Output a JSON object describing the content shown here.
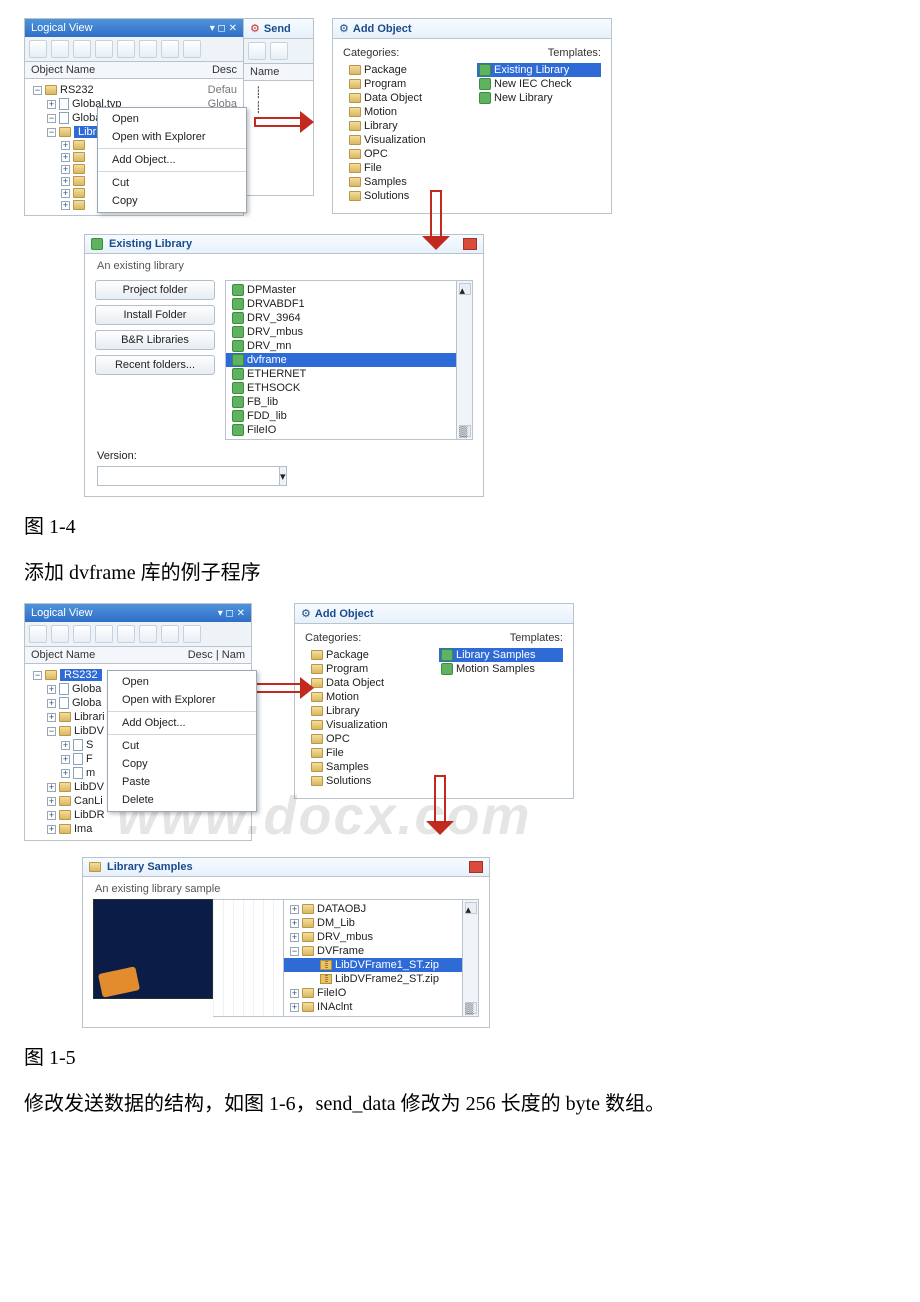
{
  "caption1": "图 1-4",
  "text_between": "添加 dvframe 库的例子程序",
  "caption2": "图 1-5",
  "text_after": "修改发送数据的结构，如图 1-6，send_data 修改为 256 长度的 byte 数组。",
  "watermark": "www.docx.com",
  "fig1": {
    "logical_view": {
      "title": "Logical View",
      "col_name": "Object Name",
      "col_desc": "Desc",
      "rows": [
        {
          "indent": 0,
          "exp": "−",
          "icon": "folder",
          "label": "RS232",
          "right": "Defau"
        },
        {
          "indent": 1,
          "exp": "+",
          "icon": "file",
          "label": "Global.typ",
          "right": "Globa"
        },
        {
          "indent": 1,
          "exp": "−",
          "icon": "file",
          "label": "Global.var",
          "right": "Globa"
        },
        {
          "indent": 1,
          "exp": "−",
          "icon": "folder",
          "label": "Libra",
          "right": "",
          "selected": true
        },
        {
          "indent": 2,
          "exp": "+",
          "icon": "folder",
          "label": "",
          "right": ""
        },
        {
          "indent": 2,
          "exp": "+",
          "icon": "folder",
          "label": "",
          "right": ""
        },
        {
          "indent": 2,
          "exp": "+",
          "icon": "folder",
          "label": "",
          "right": ""
        },
        {
          "indent": 2,
          "exp": "+",
          "icon": "folder",
          "label": "",
          "right": ""
        },
        {
          "indent": 2,
          "exp": "+",
          "icon": "folder",
          "label": "",
          "right": ""
        },
        {
          "indent": 2,
          "exp": "+",
          "icon": "folder",
          "label": "",
          "right": ""
        }
      ],
      "context_menu": [
        "Open",
        "Open with Explorer",
        "—",
        "Add Object...",
        "—",
        "Cut",
        "Copy"
      ]
    },
    "send_panel": {
      "title": "Send",
      "col": "Name"
    },
    "add_object": {
      "title": "Add Object",
      "cat_label": "Categories:",
      "tpl_label": "Templates:",
      "categories": [
        "Package",
        "Program",
        "Data Object",
        "Motion",
        "Library",
        "Visualization",
        "OPC",
        "File",
        "Samples",
        "Solutions"
      ],
      "templates": [
        {
          "label": "Existing Library",
          "sel": true
        },
        {
          "label": "New IEC Check",
          "sel": false
        },
        {
          "label": "New Library",
          "sel": false
        }
      ]
    },
    "existing_lib": {
      "title": "Existing Library",
      "subtitle": "An existing library",
      "buttons": [
        "Project folder",
        "Install Folder",
        "B&R Libraries",
        "Recent folders..."
      ],
      "version_label": "Version:",
      "libs": [
        "DPMaster",
        "DRVABDF1",
        "DRV_3964",
        "DRV_mbus",
        "DRV_mn",
        "dvframe",
        "ETHERNET",
        "ETHSOCK",
        "FB_lib",
        "FDD_lib",
        "FileIO"
      ]
    }
  },
  "fig2": {
    "logical_view": {
      "title": "Logical View",
      "col_name": "Object Name",
      "col_desc": "Desc",
      "col_name2": "Nam",
      "rows": [
        {
          "indent": 0,
          "exp": "−",
          "icon": "folder",
          "label": "RS232",
          "right": "",
          "selected": true
        },
        {
          "indent": 1,
          "exp": "+",
          "icon": "file",
          "label": "Globa",
          "right": ""
        },
        {
          "indent": 1,
          "exp": "+",
          "icon": "file",
          "label": "Globa",
          "right": ""
        },
        {
          "indent": 1,
          "exp": "+",
          "icon": "folder",
          "label": "Librari",
          "right": ""
        },
        {
          "indent": 1,
          "exp": "−",
          "icon": "folder",
          "label": "LibDV",
          "right": ""
        },
        {
          "indent": 2,
          "exp": "+",
          "icon": "file",
          "label": "S",
          "right": ""
        },
        {
          "indent": 2,
          "exp": "+",
          "icon": "file",
          "label": "F",
          "right": ""
        },
        {
          "indent": 2,
          "exp": "+",
          "icon": "file",
          "label": "m",
          "right": ""
        },
        {
          "indent": 1,
          "exp": "+",
          "icon": "folder",
          "label": "LibDV",
          "right": ""
        },
        {
          "indent": 1,
          "exp": "+",
          "icon": "folder",
          "label": "CanLi",
          "right": ""
        },
        {
          "indent": 1,
          "exp": "+",
          "icon": "folder",
          "label": "LibDR",
          "right": ""
        },
        {
          "indent": 1,
          "exp": "+",
          "icon": "folder",
          "label": "Ima",
          "right": ""
        }
      ],
      "context_menu": [
        "Open",
        "Open with Explorer",
        "—",
        "Add Object...",
        "—",
        "Cut",
        "Copy",
        "Paste",
        "Delete"
      ]
    },
    "add_object": {
      "title": "Add Object",
      "cat_label": "Categories:",
      "tpl_label": "Templates:",
      "categories": [
        "Package",
        "Program",
        "Data Object",
        "Motion",
        "Library",
        "Visualization",
        "OPC",
        "File",
        "Samples",
        "Solutions"
      ],
      "templates": [
        {
          "label": "Library Samples",
          "sel": true
        },
        {
          "label": "Motion Samples",
          "sel": false
        }
      ]
    },
    "lib_samples": {
      "title": "Library Samples",
      "subtitle": "An existing library sample",
      "tree": [
        {
          "exp": "+",
          "icon": "folder",
          "label": "DATAOBJ"
        },
        {
          "exp": "+",
          "icon": "folder",
          "label": "DM_Lib"
        },
        {
          "exp": "+",
          "icon": "folder",
          "label": "DRV_mbus"
        },
        {
          "exp": "−",
          "icon": "folder",
          "label": "DVFrame"
        },
        {
          "exp": "",
          "icon": "zip",
          "label": "LibDVFrame1_ST.zip",
          "indent": 1,
          "selected": true
        },
        {
          "exp": "",
          "icon": "zip",
          "label": "LibDVFrame2_ST.zip",
          "indent": 1
        },
        {
          "exp": "+",
          "icon": "folder",
          "label": "FileIO"
        },
        {
          "exp": "+",
          "icon": "folder",
          "label": "INAclnt"
        }
      ]
    }
  }
}
